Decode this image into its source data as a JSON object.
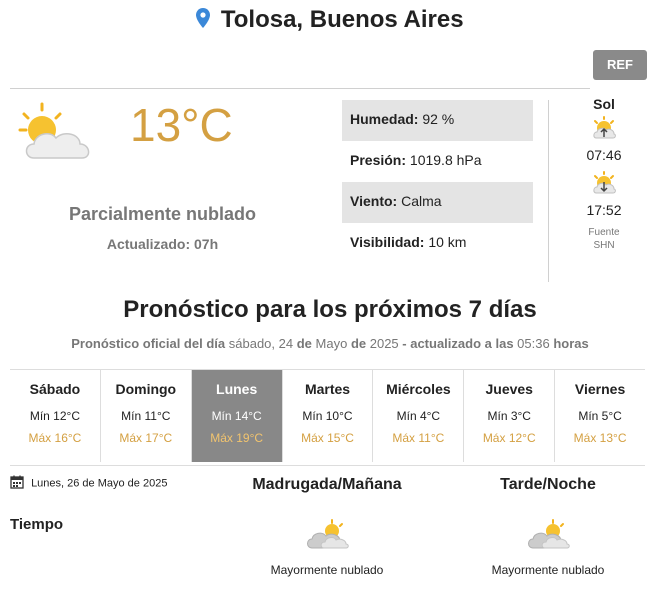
{
  "location": {
    "city": "Tolosa, Buenos Aires",
    "icon": "location-pin-icon"
  },
  "ref_button": "REF",
  "current": {
    "temperature": "13°C",
    "description": "Parcialmente nublado",
    "updated": "Actualizado: 07h",
    "icon": "partly-cloudy-icon"
  },
  "details": [
    {
      "label": "Humedad:",
      "value": "92 %"
    },
    {
      "label": "Presión:",
      "value": "1019.8 hPa"
    },
    {
      "label": "Viento:",
      "value": "Calma"
    },
    {
      "label": "Visibilidad:",
      "value": "10 km"
    }
  ],
  "sun": {
    "title": "Sol",
    "sunrise": "07:46",
    "sunset": "17:52",
    "source_label": "Fuente",
    "source": "SHN"
  },
  "forecast": {
    "title": "Pronóstico para los próximos 7 días",
    "subtitle": {
      "p1": "Pronóstico oficial del día",
      "p2": "sábado, 24",
      "p3": "de",
      "p4": "Mayo",
      "p5": "de",
      "p6": "2025",
      "p7": "- actualizado a las",
      "p8": "05:36",
      "p9": "horas"
    },
    "days": [
      {
        "name": "Sábado",
        "min": "Mín 12°C",
        "max": "Máx 16°C"
      },
      {
        "name": "Domingo",
        "min": "Mín 11°C",
        "max": "Máx 17°C"
      },
      {
        "name": "Lunes",
        "min": "Mín 14°C",
        "max": "Máx 19°C"
      },
      {
        "name": "Martes",
        "min": "Mín 10°C",
        "max": "Máx 15°C"
      },
      {
        "name": "Miércoles",
        "min": "Mín 4°C",
        "max": "Máx 11°C"
      },
      {
        "name": "Jueves",
        "min": "Mín 3°C",
        "max": "Máx 12°C"
      },
      {
        "name": "Viernes",
        "min": "Mín 5°C",
        "max": "Máx 13°C"
      }
    ],
    "selected_day": "Lunes"
  },
  "detail_day": {
    "date": "Lunes, 26 de Mayo de 2025",
    "col_morning": "Madrugada/Mañana",
    "col_evening": "Tarde/Noche",
    "row_label": "Tiempo",
    "morning": "Mayormente nublado",
    "evening": "Mayormente nublado"
  }
}
